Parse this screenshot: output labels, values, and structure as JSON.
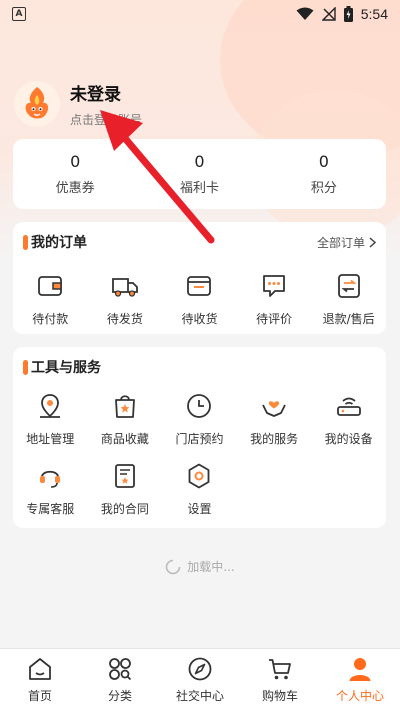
{
  "status_bar": {
    "badge": "A",
    "time": "5:54"
  },
  "profile": {
    "name": "未登录",
    "subtitle": "点击登录账号",
    "avatar_icon": "mascot-avatar-icon"
  },
  "stats": [
    {
      "value": "0",
      "label": "优惠券"
    },
    {
      "value": "0",
      "label": "福利卡"
    },
    {
      "value": "0",
      "label": "积分"
    }
  ],
  "orders": {
    "title": "我的订单",
    "more_label": "全部订单",
    "items": [
      {
        "label": "待付款",
        "icon": "wallet-icon"
      },
      {
        "label": "待发货",
        "icon": "truck-icon"
      },
      {
        "label": "待收货",
        "icon": "box-icon"
      },
      {
        "label": "待评价",
        "icon": "comment-icon"
      },
      {
        "label": "退款/售后",
        "icon": "refund-icon"
      }
    ]
  },
  "tools": {
    "title": "工具与服务",
    "items": [
      {
        "label": "地址管理",
        "icon": "location-icon"
      },
      {
        "label": "商品收藏",
        "icon": "favorite-bag-icon"
      },
      {
        "label": "门店预约",
        "icon": "clock-icon"
      },
      {
        "label": "我的服务",
        "icon": "service-hands-icon"
      },
      {
        "label": "我的设备",
        "icon": "router-icon"
      },
      {
        "label": "专属客服",
        "icon": "headset-icon"
      },
      {
        "label": "我的合同",
        "icon": "contract-icon"
      },
      {
        "label": "设置",
        "icon": "settings-icon"
      }
    ]
  },
  "loading_text": "加载中...",
  "bottom_nav": [
    {
      "label": "首页",
      "icon": "home-icon"
    },
    {
      "label": "分类",
      "icon": "category-icon"
    },
    {
      "label": "社交中心",
      "icon": "compass-icon"
    },
    {
      "label": "购物车",
      "icon": "cart-icon"
    },
    {
      "label": "个人中心",
      "icon": "person-icon",
      "active": true
    }
  ],
  "colors": {
    "accent": "#ff6a1a",
    "annotation_arrow": "#e8202a"
  }
}
